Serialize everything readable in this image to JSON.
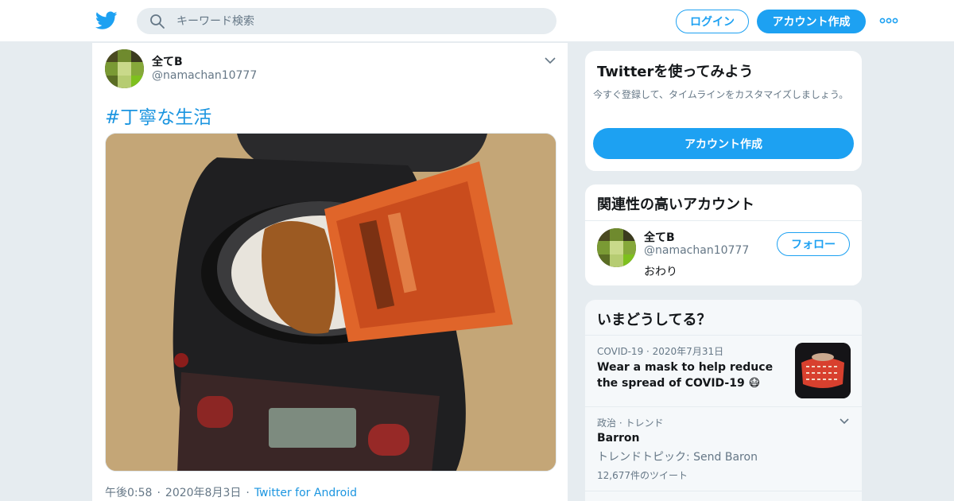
{
  "header": {
    "search_placeholder": "キーワード検索",
    "login_label": "ログイン",
    "signup_label": "アカウント作成"
  },
  "tweet": {
    "author_name": "全てB",
    "author_handle": "@namachan10777",
    "hashtag": "#丁寧な生活",
    "time": "午後0:58",
    "date": "2020年8月3日",
    "source": "Twitter for Android",
    "separator": "·"
  },
  "signup_card": {
    "title": "Twitterを使ってみよう",
    "description": "今すぐ登録して、タイムラインをカスタマイズしましょう。",
    "button_label": "アカウント作成"
  },
  "related_card": {
    "title": "関連性の高いアカウント",
    "account": {
      "name": "全てB",
      "handle": "@namachan10777",
      "bio": "おわり",
      "follow_label": "フォロー"
    }
  },
  "trends_card": {
    "title": "いまどうしてる？",
    "items": [
      {
        "category": "COVID-19 · 2020年7月31日",
        "text": "Wear a mask to help reduce the spread of COVID-19 😷"
      },
      {
        "category": "政治 · トレンド",
        "name": "Barron",
        "topic": "トレンドトピック: Send Baron",
        "count": "12,677件のツイート"
      }
    ]
  },
  "colors": {
    "accent": "#1da1f2",
    "link": "#1b95e0",
    "background": "#e6ecf0",
    "secondary_text": "#657786"
  }
}
